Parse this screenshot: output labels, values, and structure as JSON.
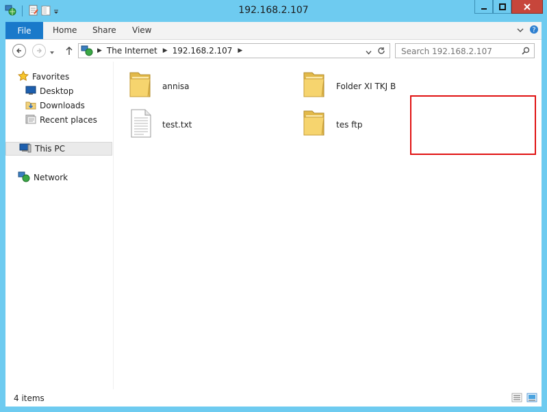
{
  "window": {
    "title": "192.168.2.107"
  },
  "ribbon": {
    "tabs": [
      "File",
      "Home",
      "Share",
      "View"
    ]
  },
  "address": {
    "crumbs": [
      "The Internet",
      "192.168.2.107"
    ],
    "search_placeholder": "Search 192.168.2.107"
  },
  "nav": {
    "favorites": "Favorites",
    "desktop": "Desktop",
    "downloads": "Downloads",
    "recent": "Recent places",
    "thispc": "This PC",
    "network": "Network"
  },
  "files": [
    {
      "name": "annisa",
      "type": "folder"
    },
    {
      "name": "Folder XI TKJ B",
      "type": "folder"
    },
    {
      "name": "test.txt",
      "type": "text-file"
    },
    {
      "name": "tes ftp",
      "type": "folder"
    }
  ],
  "status": {
    "items": "4 items"
  },
  "colors": {
    "accent": "#1979ca",
    "frame": "#6ecbf0",
    "highlight": "#e01010",
    "close": "#c7463b"
  }
}
